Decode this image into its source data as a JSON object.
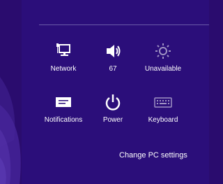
{
  "quick_settings": [
    {
      "id": "network",
      "label": "Network",
      "icon": "network-icon"
    },
    {
      "id": "volume",
      "label": "67",
      "icon": "volume-icon"
    },
    {
      "id": "brightness",
      "label": "Unavailable",
      "icon": "brightness-icon"
    },
    {
      "id": "notifications",
      "label": "Notifications",
      "icon": "notifications-icon"
    },
    {
      "id": "power",
      "label": "Power",
      "icon": "power-icon"
    },
    {
      "id": "keyboard",
      "label": "Keyboard",
      "icon": "keyboard-icon"
    }
  ],
  "footer": {
    "change_pc_settings_label": "Change PC settings"
  },
  "colors": {
    "background": "#2a0c6e",
    "panel": "#2b0e7a",
    "swirl": "#3b1a86",
    "text": "#ffffff"
  }
}
